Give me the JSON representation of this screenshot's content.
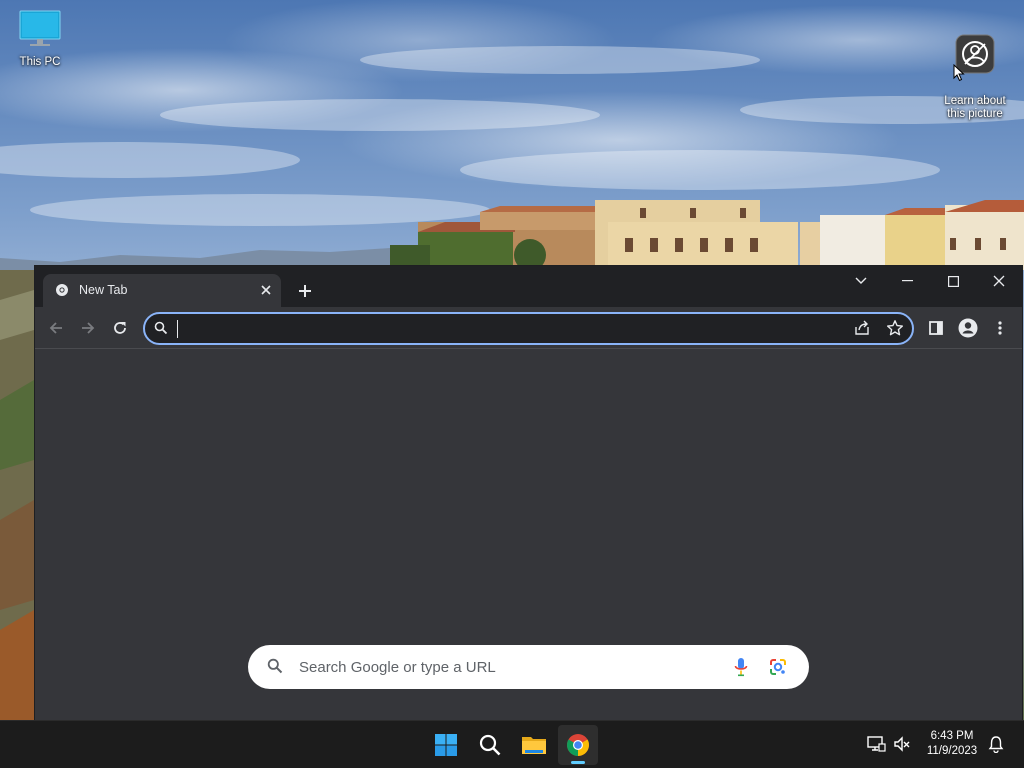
{
  "desktop": {
    "icons": [
      {
        "label": "This PC",
        "icon": "monitor-icon"
      },
      {
        "label": "Learn about\nthis picture",
        "icon": "camera-info-icon"
      }
    ]
  },
  "browser": {
    "tab": {
      "title": "New Tab",
      "icon": "chrome-favicon-icon"
    },
    "omnibox": {
      "value": "",
      "placeholder": ""
    },
    "new_tab_page": {
      "search_placeholder": "Search Google or type a URL"
    },
    "colors": {
      "frame": "#202124",
      "toolbar": "#35363a",
      "focus_ring": "#8ab4f8"
    }
  },
  "taskbar": {
    "apps": [
      "start-icon",
      "search-icon",
      "file-explorer-icon",
      "chrome-icon"
    ],
    "active_app": "chrome-icon",
    "clock": {
      "time": "6:43 PM",
      "date": "11/9/2023"
    }
  }
}
